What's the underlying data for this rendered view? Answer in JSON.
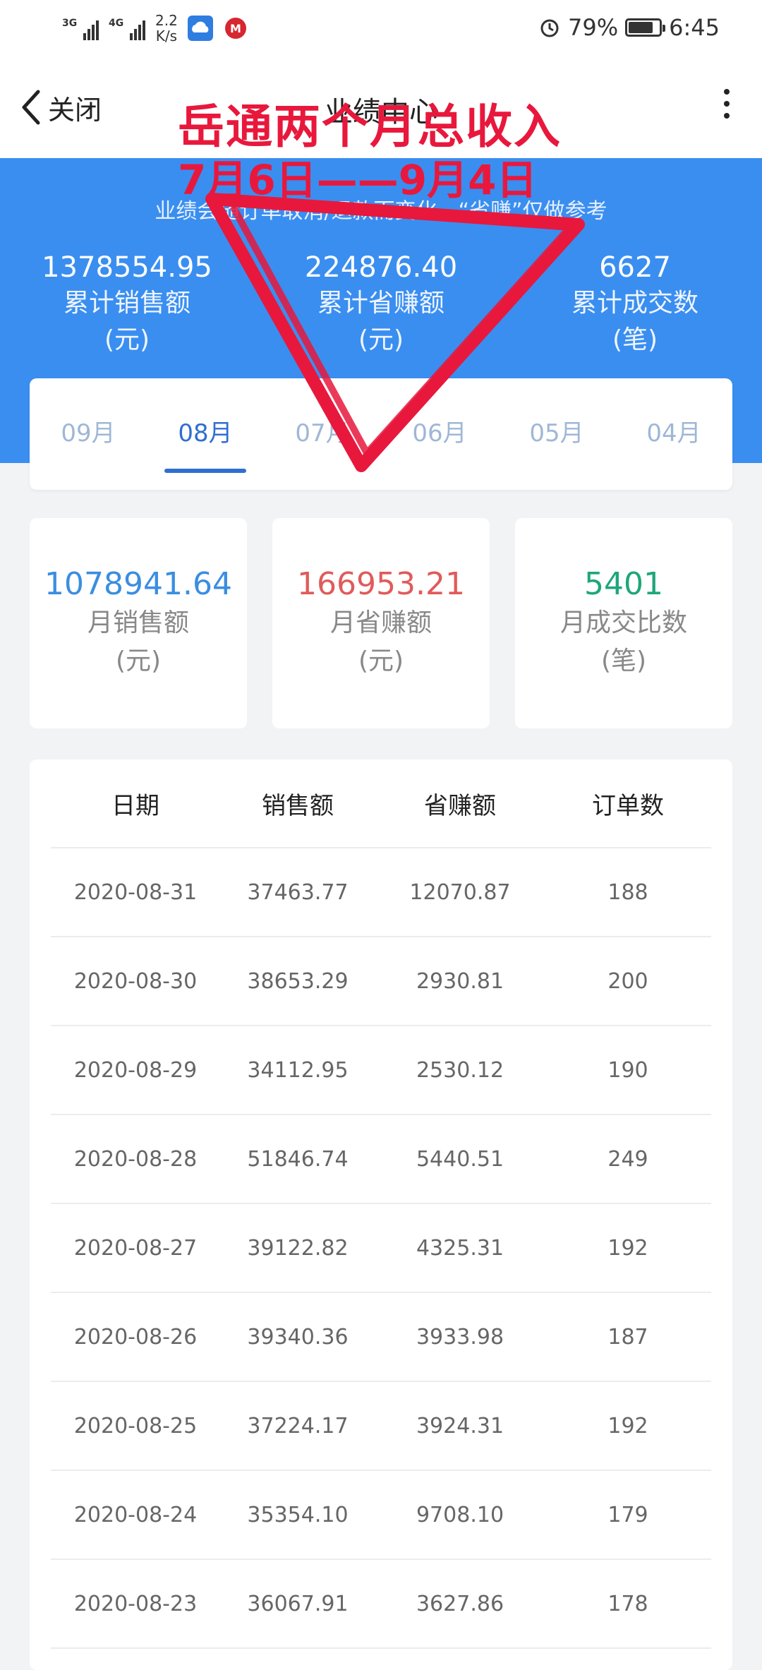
{
  "status_bar": {
    "net1": "3G",
    "net2": "4G",
    "speed_value": "2.2",
    "speed_unit": "K/s",
    "battery": "79%",
    "time": "6:45"
  },
  "nav": {
    "back_label": "关闭",
    "title": "业绩中心"
  },
  "notice": "业绩会随订单取消/退款而变化，“省赚”仅做参考",
  "totals": [
    {
      "value": "1378554.95",
      "label": "累计销售额",
      "unit": "(元)"
    },
    {
      "value": "224876.40",
      "label": "累计省赚额",
      "unit": "(元)"
    },
    {
      "value": "6627",
      "label": "累计成交数",
      "unit": "(笔)"
    }
  ],
  "tabs": [
    "09月",
    "08月",
    "07月",
    "06月",
    "05月",
    "04月"
  ],
  "active_tab": "08月",
  "monthly": [
    {
      "value": "1078941.64",
      "label": "月销售额",
      "unit": "(元)",
      "color": "#3a8ee0"
    },
    {
      "value": "166953.21",
      "label": "月省赚额",
      "unit": "(元)",
      "color": "#e15a5a"
    },
    {
      "value": "5401",
      "label": "月成交比数",
      "unit": "(笔)",
      "color": "#1fa67a"
    }
  ],
  "table": {
    "headers": [
      "日期",
      "销售额",
      "省赚额",
      "订单数"
    ],
    "rows": [
      [
        "2020-08-31",
        "37463.77",
        "12070.87",
        "188"
      ],
      [
        "2020-08-30",
        "38653.29",
        "2930.81",
        "200"
      ],
      [
        "2020-08-29",
        "34112.95",
        "2530.12",
        "190"
      ],
      [
        "2020-08-28",
        "51846.74",
        "5440.51",
        "249"
      ],
      [
        "2020-08-27",
        "39122.82",
        "4325.31",
        "192"
      ],
      [
        "2020-08-26",
        "39340.36",
        "3933.98",
        "187"
      ],
      [
        "2020-08-25",
        "37224.17",
        "3924.31",
        "192"
      ],
      [
        "2020-08-24",
        "35354.10",
        "9708.10",
        "179"
      ],
      [
        "2020-08-23",
        "36067.91",
        "3627.86",
        "178"
      ]
    ]
  },
  "annotation": {
    "line1": "岳通两个月总收入",
    "line2": "7月6日——9月4日",
    "color": "#e8183c"
  },
  "colors": {
    "header_blue": "#3a8ef0",
    "active_tab": "#2f6fd0"
  }
}
